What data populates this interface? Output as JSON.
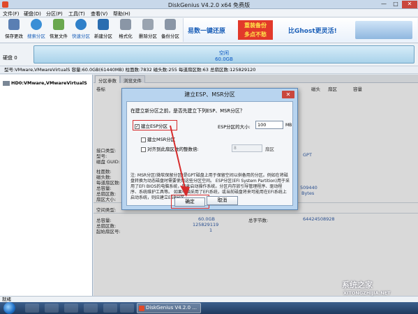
{
  "window": {
    "title": "DiskGenius V4.2.0 x64 免费版",
    "controls": {
      "minimize": "—",
      "maximize": "□",
      "close": "✕"
    }
  },
  "menu": [
    "文件(F)",
    "硬盘(D)",
    "分区(P)",
    "工具(T)",
    "查看(V)",
    "帮助(H)"
  ],
  "toolbar": [
    {
      "label": "保存更改",
      "icon": "save-icon",
      "color": "#5a7fb3"
    },
    {
      "label": "搜索分区",
      "icon": "search-partition-icon",
      "color": "#3a8fd6"
    },
    {
      "label": "恢复文件",
      "icon": "recover-file-icon",
      "color": "#6aa84f"
    },
    {
      "label": "快速分区",
      "icon": "quick-partition-icon",
      "color": "#2f80c9"
    },
    {
      "label": "新建分区",
      "icon": "new-partition-icon",
      "color": "#2a6db0"
    },
    {
      "label": "格式化",
      "icon": "format-icon",
      "color": "#8a96a6"
    },
    {
      "label": "删除分区",
      "icon": "delete-partition-icon",
      "color": "#9aa4b0"
    },
    {
      "label": "备份分区",
      "icon": "backup-partition-icon",
      "color": "#8a96a6"
    }
  ],
  "banner": {
    "left_text": "易数一键还原",
    "promo_line1": "重装备份",
    "promo_line2": "多点不愁",
    "right_text": "比Ghost更灵活!"
  },
  "disk": {
    "label": "硬盘 0",
    "bar_line1": "空闲",
    "bar_line2": "60.0GB",
    "info": "型号:VMware,VMwareVirtualS  容量:60.0GB(61440MB)  柱面数:7832  磁头数:255  每道扇区数:63  总扇区数:125829120"
  },
  "tree": {
    "item": "HD0:VMware,VMwareVirtualS"
  },
  "tabs": [
    "分区参数",
    "浏览文件"
  ],
  "table_headers": [
    "卷标",
    "磁头",
    "扇区",
    "容量"
  ],
  "details": {
    "interface_type": "接口类型:",
    "model": "型号:",
    "disk_guid": "磁盘 GUID:",
    "cylinders": "柱面数:",
    "heads": "磁头数:",
    "sectors_per_track": "每道扇区数:",
    "total_capacity": "总容量:",
    "total_sectors": "总扇区数:",
    "sector_size": "扇区大小:",
    "physical_sector_size": "物理扇区大小:",
    "gpt": "GPT",
    "val_a": "509440",
    "val_b": "Bytes",
    "free_space_type": "空间类型:",
    "total_capacity_2": "总容量:",
    "total_sectors_2": "总扇区数:",
    "start_sector": "起始扇区号:",
    "capacity_value": "60.0GB",
    "sectors_value": "125829119",
    "start_value": "1",
    "total_bytes_label": "总字节数:",
    "total_bytes_value": "64424508928"
  },
  "dialog": {
    "title": "建立ESP、MSR分区",
    "question": "在建立新分区之前，是否先建立下列ESP、MSR分区？",
    "chk_esp": "建立ESP分区",
    "chk_msr": "建立MSR分区",
    "chk_align": "对齐到此扇区数的整数倍:",
    "esp_size_label": "ESP分区的大小:",
    "esp_size_value": "100",
    "esp_size_unit": "MB",
    "align_value": "8",
    "align_unit": "扇区",
    "note": "注: MSR分区(微软保留分区)是GPT磁盘上用于保留空间以供备用的分区。例如在将磁盘转换为动态磁盘时需要使用这些分区空间。 ESP分区(EFI System Partition)用于采用了EFI BIOS的电脑系统，用来启动操作系统。分区内存放引导管理程序、驱动程序、系统维护工具等。 如果电脑采用了EFI系统，或当前磁盘将来可能用在EFI系统上启动系统，则应建立ESP分区。",
    "ok_label": "确定",
    "cancel_label": "取消",
    "close": "✕"
  },
  "status": "就绪",
  "taskbar": {
    "task_label": "DiskGenius V4.2.0 ..."
  },
  "watermark": {
    "main": "系统之家",
    "sub": "XITONGZHIJIA.NET"
  },
  "colors": {
    "highlight": "#d62c2c",
    "link_blue": "#0b3f99",
    "dialog_frame": "#b8d4ef"
  }
}
